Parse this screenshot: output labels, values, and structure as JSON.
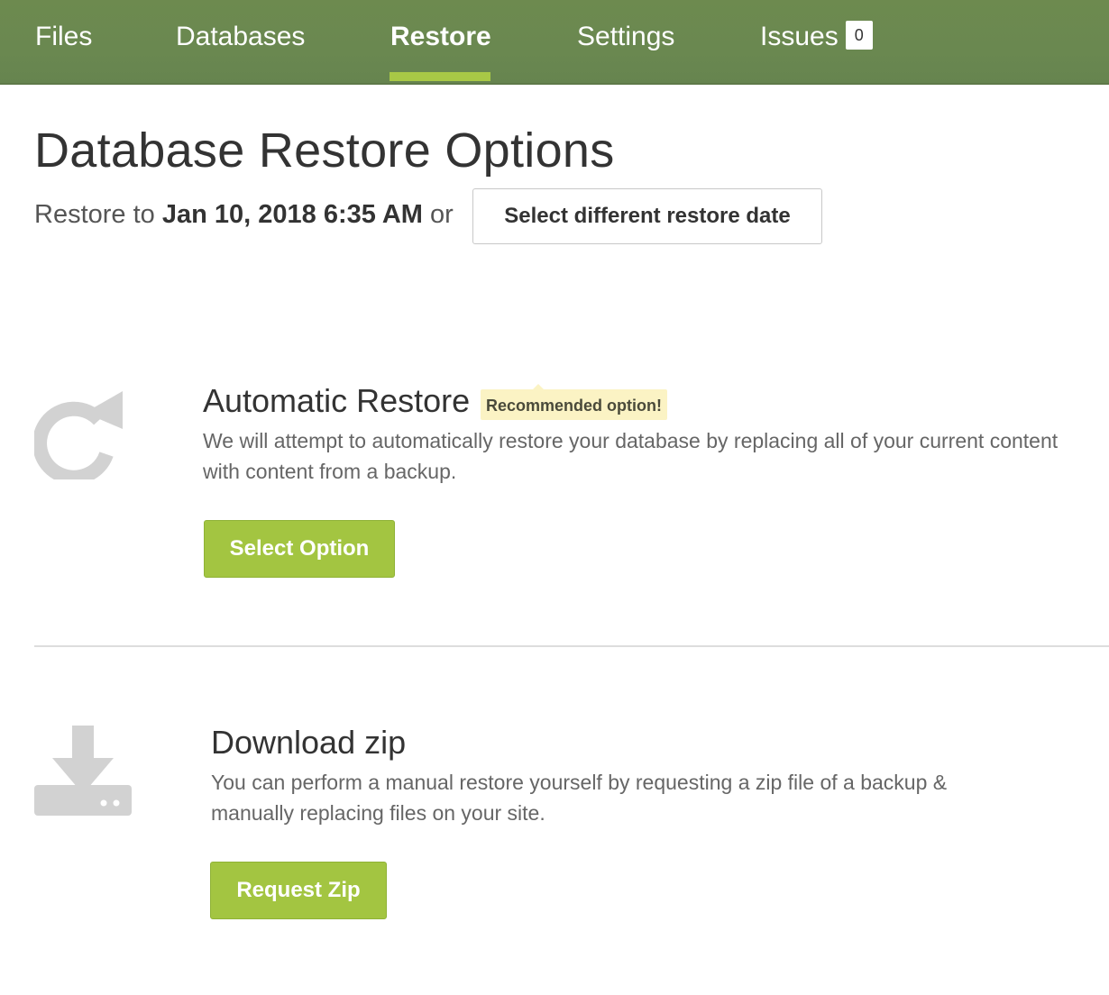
{
  "nav": {
    "tabs": [
      {
        "label": "Files"
      },
      {
        "label": "Databases"
      },
      {
        "label": "Restore"
      },
      {
        "label": "Settings"
      },
      {
        "label": "Issues"
      }
    ],
    "active_tab": "Restore",
    "issues_count": "0"
  },
  "page": {
    "title": "Database Restore Options",
    "restore_prefix": "Restore to",
    "restore_date": "Jan 10, 2018 6:35 AM",
    "restore_suffix": "or",
    "date_button_label": "Select different restore date"
  },
  "options": [
    {
      "icon": "refresh-icon",
      "title": "Automatic Restore",
      "badge": "Recommended option!",
      "description": "We will attempt to automatically restore your database by replacing all of your current content with content from a backup.",
      "button_label": "Select Option"
    },
    {
      "icon": "download-icon",
      "title": "Download zip",
      "description": "You can perform a manual restore yourself by requesting a zip file of a backup & manually replacing files on your site.",
      "button_label": "Request Zip"
    }
  ],
  "colors": {
    "nav_background": "#6a8850",
    "active_underline": "#a8c846",
    "button_green": "#a3c541",
    "badge_yellow": "#fbf3c4",
    "icon_gray": "#d2d2d2"
  }
}
